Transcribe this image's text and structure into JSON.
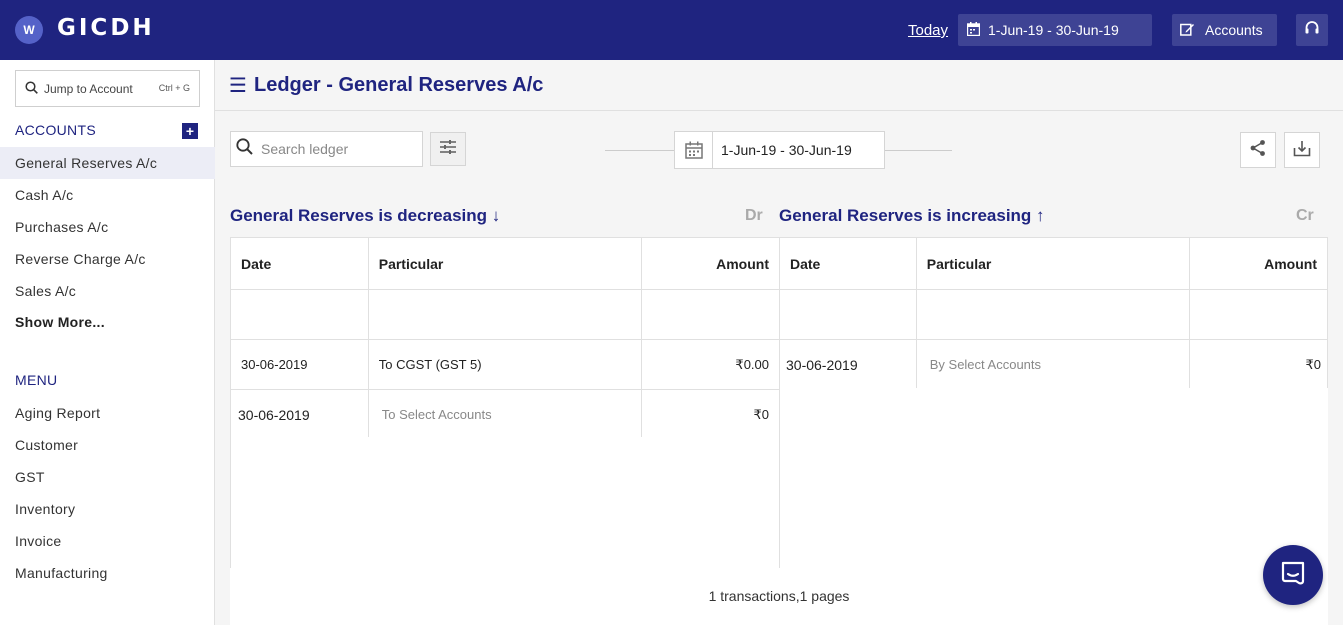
{
  "topbar": {
    "avatar_initial": "W",
    "logo": "GICDH",
    "today_label": "Today",
    "date_range": "1-Jun-19 - 30-Jun-19",
    "accounts_label": "Accounts"
  },
  "sidebar": {
    "jump_placeholder": "Jump to Account",
    "jump_shortcut": "Ctrl + G",
    "accounts_title": "ACCOUNTS",
    "accounts": [
      {
        "label": "General Reserves A/c",
        "active": true
      },
      {
        "label": "Cash A/c"
      },
      {
        "label": "Purchases A/c"
      },
      {
        "label": "Reverse Charge A/c"
      },
      {
        "label": "Sales A/c"
      }
    ],
    "show_more": "Show More...",
    "menu_title": "MENU",
    "menu": [
      "Aging Report",
      "Customer",
      "GST",
      "Inventory",
      "Invoice",
      "Manufacturing"
    ]
  },
  "page": {
    "title": "Ledger - General Reserves A/c",
    "search_placeholder": "Search ledger",
    "date_range": "1-Jun-19 - 30-Jun-19",
    "debit_heading": "General Reserves is decreasing ↓",
    "debit_tag": "Dr",
    "credit_heading": "General Reserves is increasing ↑",
    "credit_tag": "Cr",
    "columns": {
      "date": "Date",
      "particular": "Particular",
      "amount": "Amount"
    },
    "debit_rows": [
      {
        "date": "",
        "particular": "",
        "amount": ""
      },
      {
        "date": "30-06-2019",
        "particular": "To CGST (GST 5)",
        "amount": "₹0.00"
      },
      {
        "date": "30-06-2019",
        "particular": "To Select Accounts",
        "amount": "₹0"
      }
    ],
    "credit_rows": [
      {
        "date": "",
        "particular": "",
        "amount": ""
      },
      {
        "date": "30-06-2019",
        "particular": "By Select Accounts",
        "amount": "₹0"
      }
    ],
    "footer": "1 transactions,1 pages"
  }
}
